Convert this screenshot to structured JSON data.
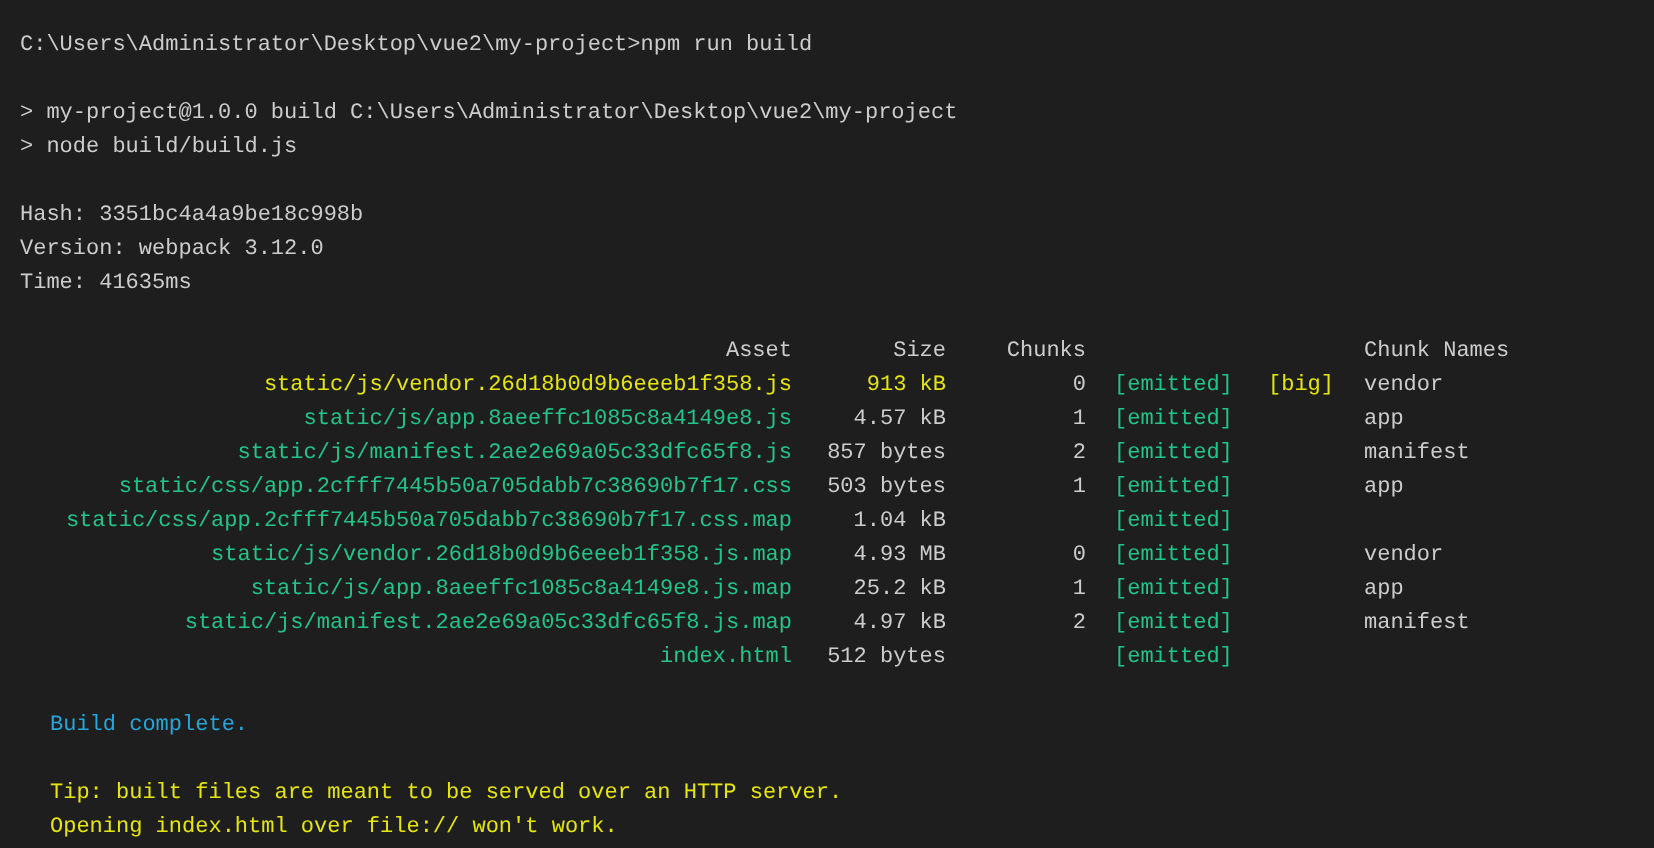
{
  "blocks_before": [
    [
      {
        "kind": "plain",
        "text": "C:\\Users\\Administrator\\Desktop\\vue2\\my-project>npm run build"
      }
    ],
    [
      {
        "kind": "plain",
        "text": "> my-project@1.0.0 build C:\\Users\\Administrator\\Desktop\\vue2\\my-project"
      },
      {
        "kind": "plain",
        "text": "> node build/build.js"
      }
    ],
    [
      {
        "kind": "plain",
        "text": "Hash: 3351bc4a4a9be18c998b"
      },
      {
        "kind": "plain",
        "text": "Version: webpack 3.12.0"
      },
      {
        "kind": "plain",
        "text": "Time: 41635ms"
      }
    ]
  ],
  "table": {
    "columns": [
      "Asset",
      "Size",
      "Chunks",
      "Chunk Names"
    ],
    "rows": [
      {
        "asset": "static/js/vendor.26d18b0d9b6eeeb1f358.js",
        "size": "913 kB",
        "chunks": "0",
        "status": "[emitted]",
        "flag": "[big]",
        "chunk_names": "vendor",
        "oversized": true
      },
      {
        "asset": "static/js/app.8aeeffc1085c8a4149e8.js",
        "size": "4.57 kB",
        "chunks": "1",
        "status": "[emitted]",
        "chunk_names": "app",
        "oversized": false
      },
      {
        "asset": "static/js/manifest.2ae2e69a05c33dfc65f8.js",
        "size": "857 bytes",
        "chunks": "2",
        "status": "[emitted]",
        "chunk_names": "manifest",
        "oversized": false
      },
      {
        "asset": "static/css/app.2cfff7445b50a705dabb7c38690b7f17.css",
        "size": "503 bytes",
        "chunks": "1",
        "status": "[emitted]",
        "chunk_names": "app",
        "oversized": false
      },
      {
        "asset": "static/css/app.2cfff7445b50a705dabb7c38690b7f17.css.map",
        "size": "1.04 kB",
        "status": "[emitted]",
        "oversized": false
      },
      {
        "asset": "static/js/vendor.26d18b0d9b6eeeb1f358.js.map",
        "size": "4.93 MB",
        "chunks": "0",
        "status": "[emitted]",
        "chunk_names": "vendor",
        "oversized": false
      },
      {
        "asset": "static/js/app.8aeeffc1085c8a4149e8.js.map",
        "size": "25.2 kB",
        "chunks": "1",
        "status": "[emitted]",
        "chunk_names": "app",
        "oversized": false
      },
      {
        "asset": "static/js/manifest.2ae2e69a05c33dfc65f8.js.map",
        "size": "4.97 kB",
        "chunks": "2",
        "status": "[emitted]",
        "chunk_names": "manifest",
        "oversized": false
      },
      {
        "asset": "index.html",
        "size": "512 bytes",
        "status": "[emitted]",
        "oversized": false
      }
    ]
  },
  "blocks_after": [
    [
      {
        "kind": "success",
        "text": "Build complete."
      }
    ],
    [
      {
        "kind": "tip",
        "text": "Tip: built files are meant to be served over an HTTP server."
      },
      {
        "kind": "tip",
        "text": "Opening index.html over file:// won't work."
      }
    ]
  ]
}
